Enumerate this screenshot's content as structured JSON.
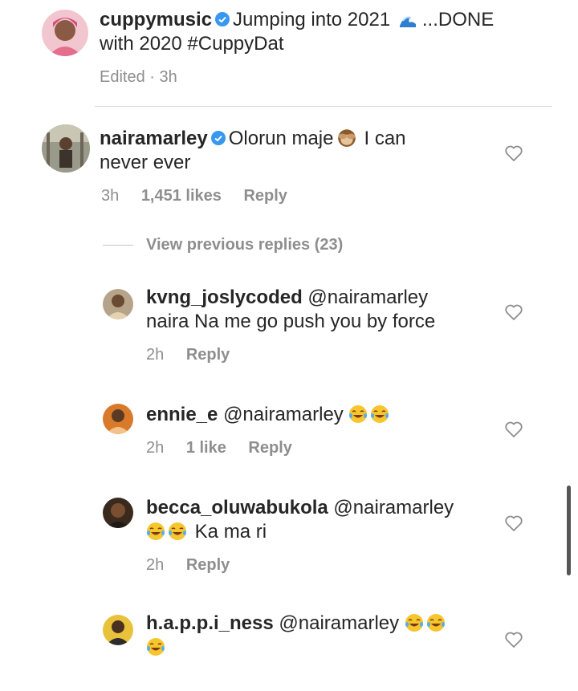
{
  "post": {
    "username": "cuppymusic",
    "caption_a": "Jumping into 2021",
    "caption_b": "...DONE",
    "caption_c": "with 2020",
    "hashtag": "#CuppyDat",
    "edited": "Edited · 3h",
    "wave_icon": "wave-icon"
  },
  "comment": {
    "username": "nairamarley",
    "text_a": "Olorun maje",
    "text_b": "I can",
    "text_c": "never ever",
    "time": "3h",
    "likes": "1,451 likes",
    "reply": "Reply",
    "emoji_icon": "see-no-evil-monkey-icon"
  },
  "view_previous": "View previous replies (23)",
  "replies": [
    {
      "username": "kvng_joslycoded",
      "mention": "@nairamarley",
      "text": "naira Na me go push you by force",
      "time": "2h",
      "likes": "",
      "reply": "Reply"
    },
    {
      "username": "ennie_e",
      "mention": "@nairamarley",
      "text": "",
      "time": "2h",
      "likes": "1 like",
      "reply": "Reply"
    },
    {
      "username": "becca_oluwabukola",
      "mention": "@nairamarley",
      "text": "Ka ma ri",
      "time": "2h",
      "likes": "",
      "reply": "Reply"
    },
    {
      "username": "h.a.p.p.i_ness",
      "mention": "@nairamarley",
      "text": "",
      "time": "",
      "likes": "",
      "reply": ""
    }
  ],
  "colors": {
    "text": "#262626",
    "meta": "#8e8e8e",
    "link": "#262626",
    "verified": "#3897f0",
    "divider": "#dbdbdb"
  }
}
